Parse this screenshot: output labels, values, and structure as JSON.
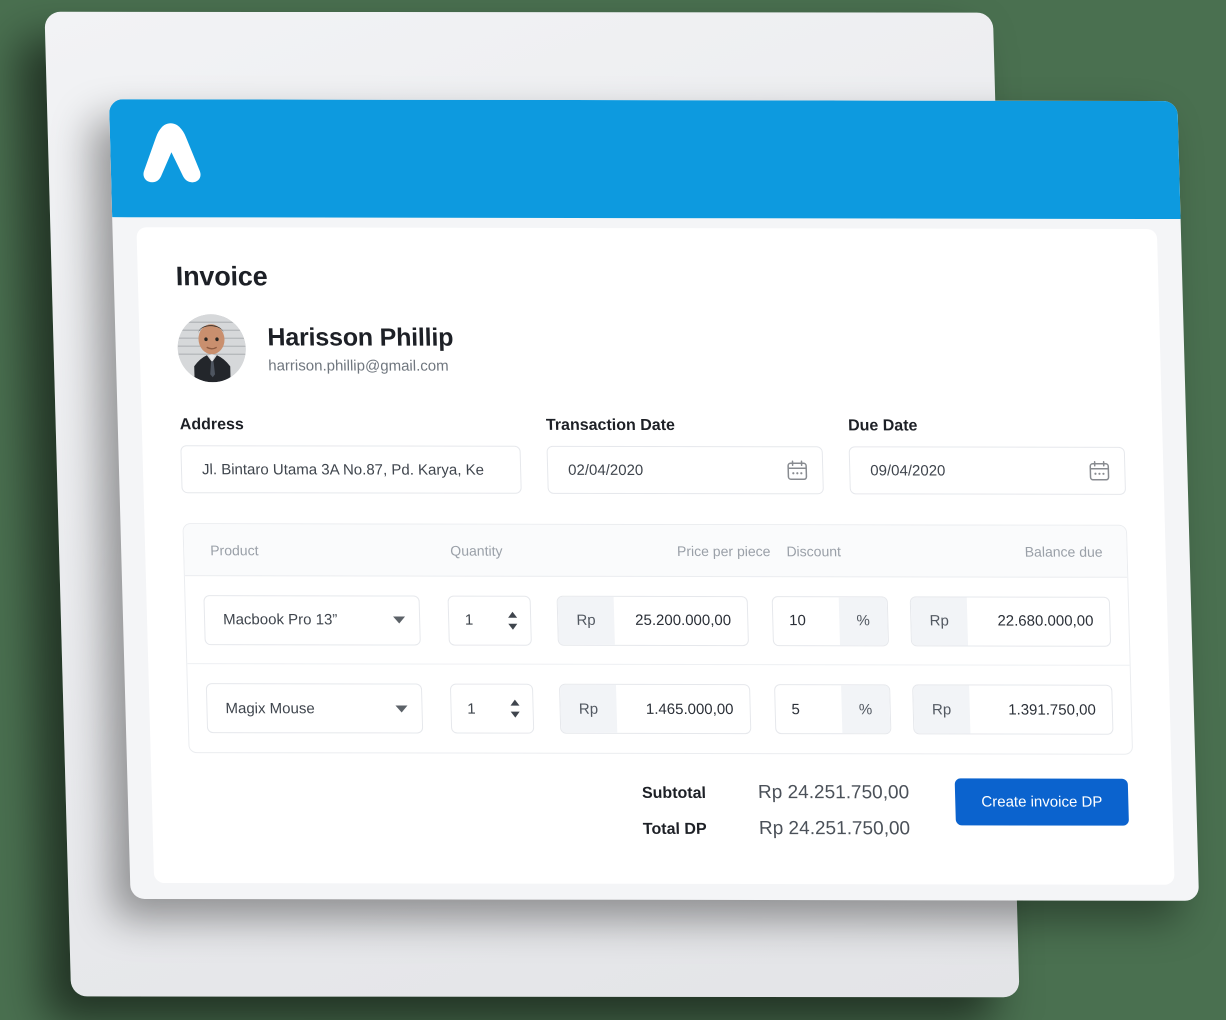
{
  "brand": {
    "logo_icon": "chevron-a-logo",
    "banner_color": "#0d9adf",
    "button_color": "#0b63ce",
    "background_color": "#4a7050"
  },
  "page": {
    "title": "Invoice"
  },
  "user": {
    "name": "Harisson Phillip",
    "email": "harrison.phillip@gmail.com",
    "avatar_icon": "user-photo-avatar"
  },
  "form": {
    "address": {
      "label": "Address",
      "value": "Jl. Bintaro Utama 3A No.87, Pd. Karya, Ke"
    },
    "transaction_date": {
      "label": "Transaction Date",
      "value": "02/04/2020",
      "icon": "calendar-icon"
    },
    "due_date": {
      "label": "Due Date",
      "value": "09/04/2020",
      "icon": "calendar-icon"
    }
  },
  "table": {
    "headers": {
      "product": "Product",
      "quantity": "Quantity",
      "price": "Price per piece",
      "discount": "Discount",
      "balance": "Balance due"
    },
    "currency_prefix": "Rp",
    "percent_suffix": "%",
    "rows": [
      {
        "product": "Macbook Pro 13”",
        "quantity": "1",
        "price": "25.200.000,00",
        "discount": "10",
        "balance": "22.680.000,00"
      },
      {
        "product": "Magix Mouse",
        "quantity": "1",
        "price": "1.465.000,00",
        "discount": "5",
        "balance": "1.391.750,00"
      }
    ]
  },
  "totals": {
    "subtotal_label": "Subtotal",
    "subtotal_value": "Rp 24.251.750,00",
    "total_dp_label": "Total DP",
    "total_dp_value": "Rp 24.251.750,00"
  },
  "actions": {
    "create_invoice": "Create invoice DP"
  }
}
